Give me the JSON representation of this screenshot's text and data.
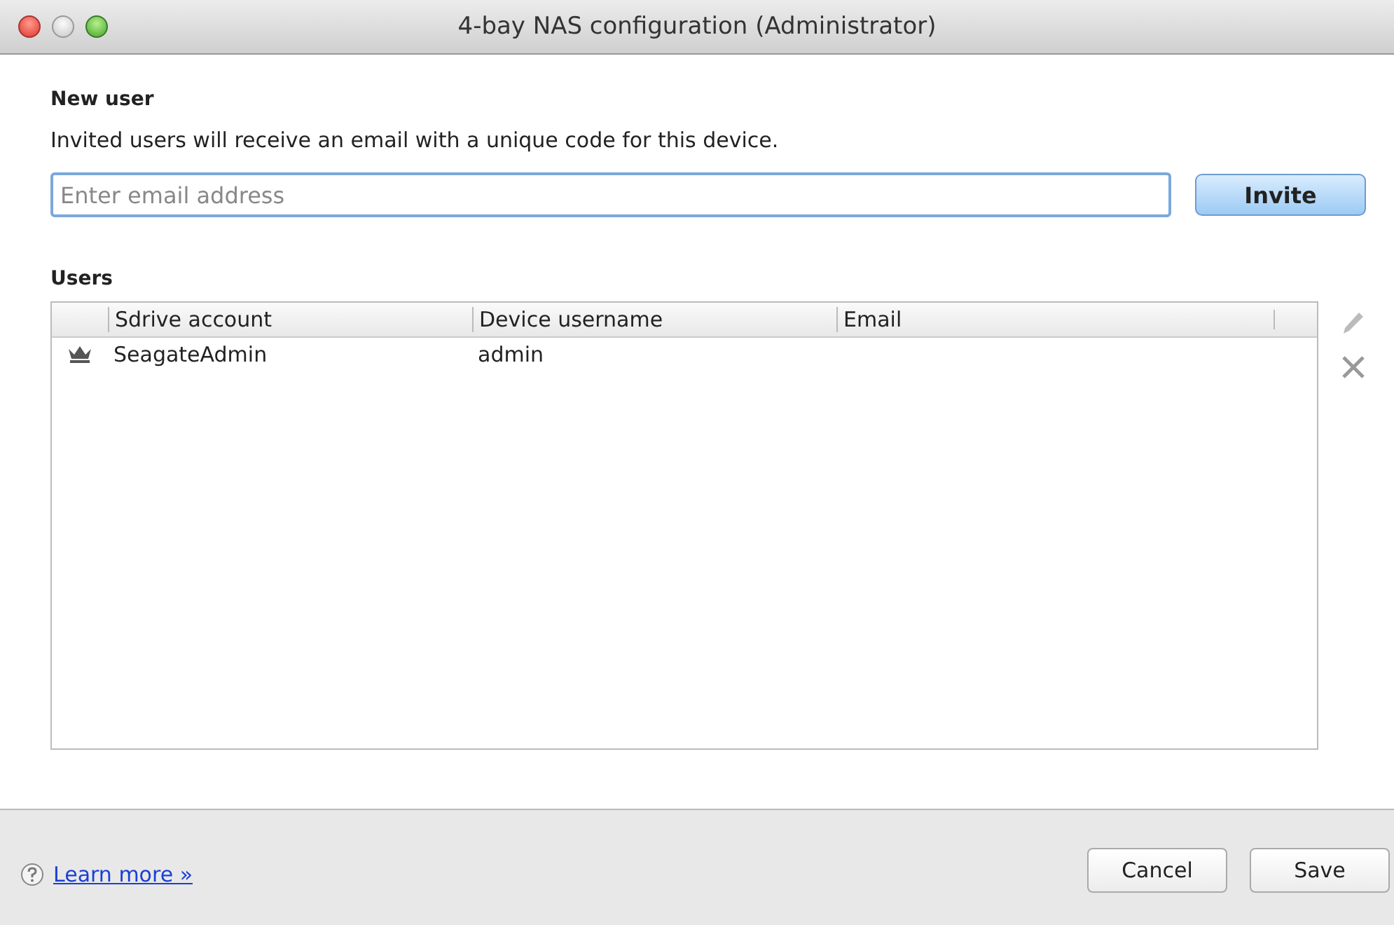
{
  "window": {
    "title": "4-bay NAS configuration (Administrator)"
  },
  "new_user": {
    "heading": "New user",
    "description": "Invited users will receive an email with a unique code for this device.",
    "email_field": {
      "placeholder": "Enter email address"
    },
    "invite_button": "Invite"
  },
  "users": {
    "heading": "Users",
    "columns": [
      "Sdrive account",
      "Device username",
      "Email"
    ],
    "rows": [
      {
        "kind": "admin",
        "cells": [
          "SeagateAdmin",
          "admin",
          ""
        ]
      }
    ]
  },
  "footer": {
    "help_link": "Learn more »",
    "buttons": [
      "Cancel",
      "Save"
    ]
  }
}
